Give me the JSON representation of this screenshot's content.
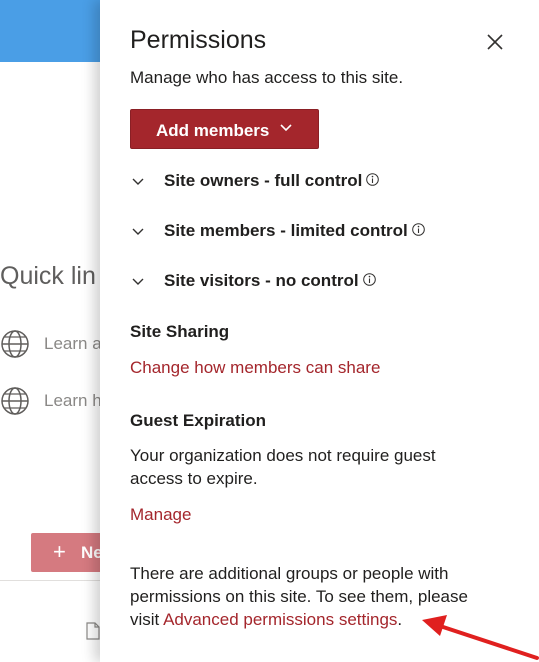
{
  "background": {
    "quick_links_title": "Quick lin",
    "links": [
      {
        "label": "Learn a"
      },
      {
        "label": "Learn h"
      }
    ],
    "new_button_label": "Ne"
  },
  "panel": {
    "title": "Permissions",
    "subtitle": "Manage who has access to this site.",
    "add_members_label": "Add members",
    "groups": [
      {
        "label": "Site owners - full control"
      },
      {
        "label": "Site members - limited control"
      },
      {
        "label": "Site visitors - no control"
      }
    ],
    "site_sharing": {
      "heading": "Site Sharing",
      "link": "Change how members can share"
    },
    "guest_expiration": {
      "heading": "Guest Expiration",
      "text": "Your organization does not require guest access to expire.",
      "link": "Manage"
    },
    "footer": {
      "text_before": "There are additional groups or people with permissions on this site. To see them, please visit ",
      "link": "Advanced permissions settings",
      "text_after": "."
    }
  },
  "colors": {
    "accent": "#a4262c",
    "annotation_arrow": "#e0201f",
    "header_blue": "#4a9ee6"
  },
  "icons": [
    "close-icon",
    "chevron-down-icon",
    "info-icon",
    "globe-icon",
    "plus-icon",
    "document-icon"
  ]
}
